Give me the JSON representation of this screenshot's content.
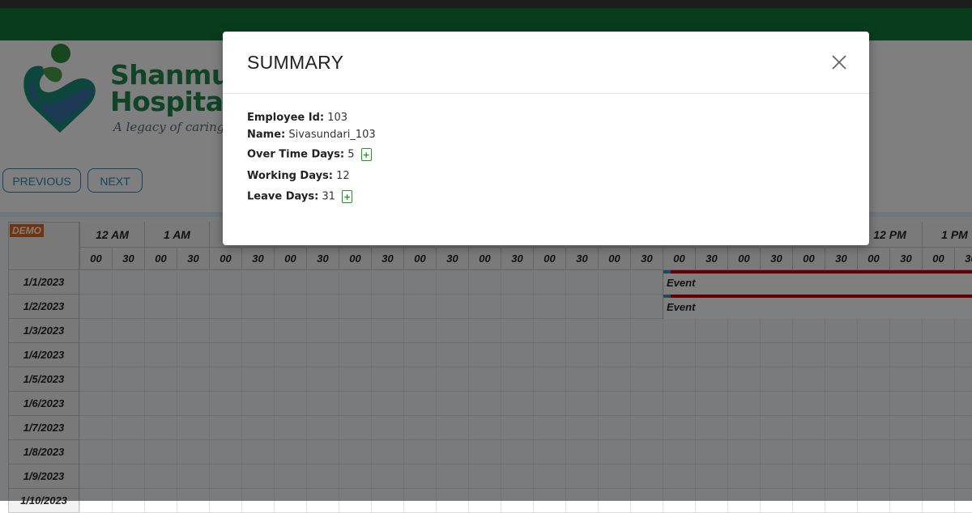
{
  "brand": {
    "name_line1": "Shanmug",
    "name_line2": "Hospital",
    "tagline": "A legacy of caring"
  },
  "nav": {
    "previous_label": "PREVIOUS",
    "next_label": "NEXT"
  },
  "scheduler": {
    "demo_badge": "DEMO",
    "hours": [
      "12 AM",
      "1 AM",
      "",
      "",
      "",
      "",
      "",
      "",
      "",
      "",
      "",
      "",
      "12 PM",
      "1 PM"
    ],
    "minute_labels": [
      "00",
      "30"
    ],
    "rows": [
      "1/1/2023",
      "1/2/2023",
      "1/3/2023",
      "1/4/2023",
      "1/5/2023",
      "1/6/2023",
      "1/7/2023",
      "1/8/2023",
      "1/9/2023",
      "1/10/2023"
    ],
    "events": [
      {
        "row": "1/1/2023",
        "label": "Event"
      },
      {
        "row": "1/2/2023",
        "label": "Event"
      }
    ],
    "colors": {
      "event_bar": "#cc0000",
      "event_handle": "#4a90c2",
      "demo_badge": "#e06a1b"
    }
  },
  "modal": {
    "title": "SUMMARY",
    "employee_id_label": "Employee Id:",
    "employee_id": "103",
    "name_label": "Name:",
    "name": "Sivasundari_103",
    "overtime_label": "Over Time Days:",
    "overtime": "5",
    "working_label": "Working Days:",
    "working": "12",
    "leave_label": "Leave Days:",
    "leave": "31",
    "plus_symbol": "+"
  },
  "colors": {
    "header_green": "#0e7a3b",
    "brand_green": "#1f8a4c",
    "nav_accent": "#2a8ab8",
    "plus_green": "#1a9b1a"
  }
}
